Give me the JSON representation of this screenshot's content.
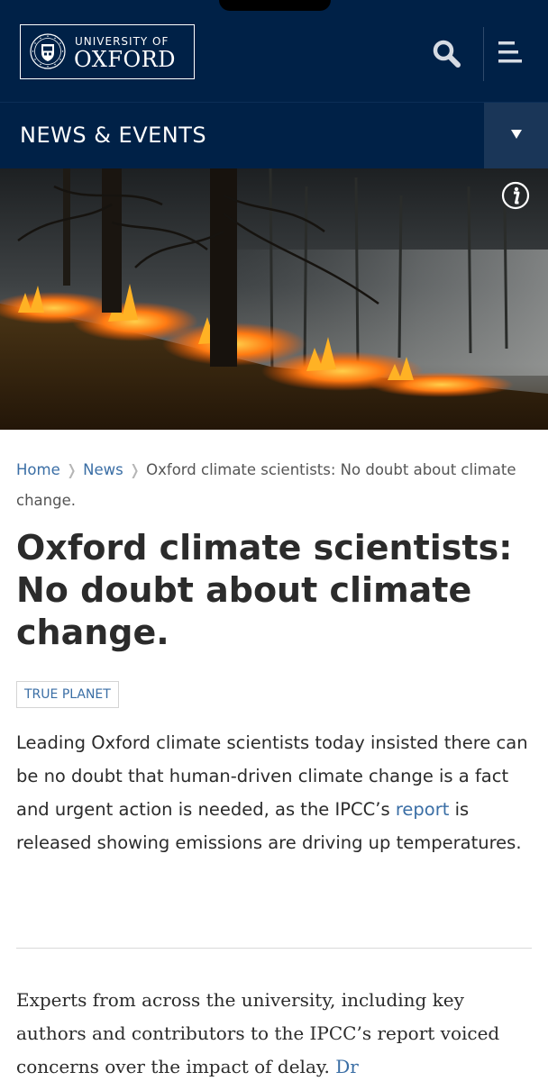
{
  "header": {
    "logo_line1": "UNIVERSITY OF",
    "logo_line2": "OXFORD",
    "brand_color": "#002147"
  },
  "section": {
    "title": "NEWS & EVENTS"
  },
  "breadcrumb": {
    "items": [
      "Home",
      "News"
    ],
    "current": "Oxford climate scientists: No doubt about climate change."
  },
  "article": {
    "title": "Oxford climate scientists: No doubt about climate change.",
    "tag": "TRUE PLANET",
    "lede_before": "Leading Oxford climate scientists today insisted there can be no doubt that human-driven climate change is a fact and urgent action is needed, as the IPCC’s ",
    "lede_link": "report",
    "lede_after": " is released showing emissions are driving up temperatures.",
    "body_text": "Experts from across the university, including key authors and contributors to the IPCC’s report voiced concerns over the impact of delay. ",
    "body_link": "Dr"
  },
  "icons": {
    "search": "search-icon",
    "menu": "hamburger-menu-icon",
    "dropdown": "caret-down-icon",
    "info": "info-icon",
    "crest": "oxford-crest-icon"
  },
  "colors": {
    "link": "#3a6ea5",
    "text": "#2b2b2b"
  }
}
